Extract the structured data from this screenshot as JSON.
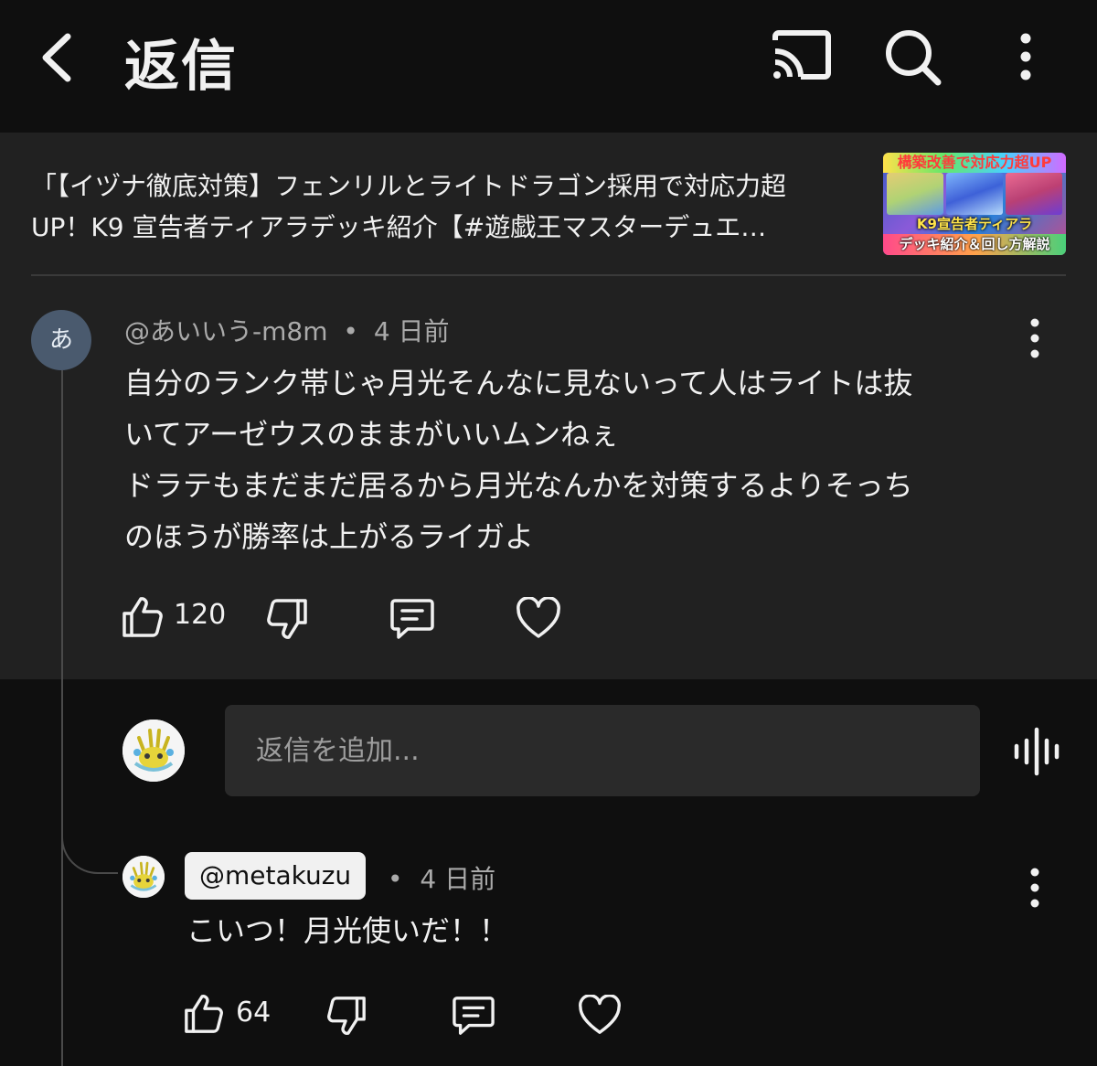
{
  "header": {
    "title": "返信",
    "back_icon": "chevron-left-icon",
    "cast_icon": "cast-icon",
    "search_icon": "search-icon",
    "more_icon": "more-vertical-icon"
  },
  "video": {
    "title_line1": "「【イヅナ徹底対策】フェンリルとライトドラゴン採用で対応力超",
    "title_line2": "UP！K9 宣告者ティアラデッキ紹介【#遊戯王マスターデュエ…",
    "thumbnail": {
      "top_text": "構築改善で対応力超UP",
      "mid_text": "K9宣告者ティアラ",
      "bottom_text": "デッキ紹介＆回し方解説"
    }
  },
  "comment": {
    "avatar_letter": "あ",
    "author": "@あいいう-m8m",
    "separator": "•",
    "time": "4 日前",
    "lines": [
      "自分のランク帯じゃ月光そんなに見ないって人はライトは抜",
      "いてアーゼウスのままがいいムンねぇ",
      "ドラテもまだまだ居るから月光なんかを対策するよりそっち",
      "のほうが勝率は上がるライガよ"
    ],
    "likes": "120"
  },
  "reply_box": {
    "placeholder": "返信を追加..."
  },
  "reply": {
    "author": "@metakuzu",
    "separator": "•",
    "time": "4 日前",
    "text": "こいつ！月光使いだ！！",
    "likes": "64"
  }
}
